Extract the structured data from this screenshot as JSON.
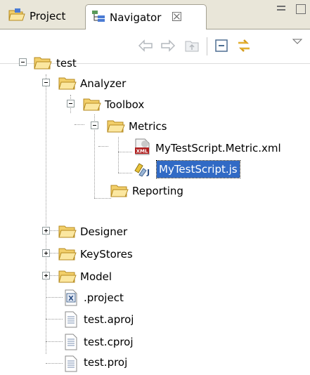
{
  "tabs": [
    {
      "label": "Project",
      "icon": "project-folder-icon"
    },
    {
      "label": "Navigator",
      "icon": "navigator-icon",
      "close": "☒"
    }
  ],
  "toolbar": {
    "icons": [
      "back-icon",
      "forward-icon",
      "up-folder-icon",
      "collapse-all-icon",
      "link-with-editor-icon",
      "view-menu-icon"
    ]
  },
  "tree": {
    "test": "test",
    "analyzer": "Analyzer",
    "toolbox": "Toolbox",
    "metrics": "Metrics",
    "metric_xml": "MyTestScript.Metric.xml",
    "test_script_js": "MyTestScript.js",
    "reporting": "Reporting",
    "designer": "Designer",
    "keystores": "KeyStores",
    "model": "Model",
    "project_file": ".project",
    "aproj": "test.aproj",
    "cproj": "test.cproj",
    "proj": "test.proj"
  },
  "colors": {
    "selection": "#316ac5",
    "folder": "#f2cf6a",
    "tabbar": "#e9e6d9"
  }
}
